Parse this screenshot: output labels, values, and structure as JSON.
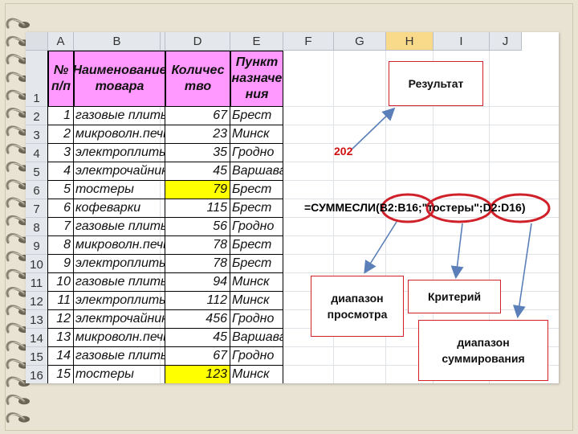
{
  "columns": [
    "A",
    "B",
    "",
    "D",
    "E",
    "F",
    "G",
    "H",
    "I",
    "J"
  ],
  "selected_column": "H",
  "rows": [
    "1",
    "2",
    "3",
    "4",
    "5",
    "6",
    "7",
    "8",
    "9",
    "10",
    "11",
    "12",
    "13",
    "14",
    "15",
    "16"
  ],
  "table_header": {
    "num": "№\nп/п",
    "name": "Наименование\nтовара",
    "qty": "Количес\nтво",
    "dest": "Пункт\nназначе\nния"
  },
  "table_rows": [
    {
      "num": "1",
      "name": "газовые плиты",
      "qty": "67",
      "dest": "Брест",
      "highlight": false
    },
    {
      "num": "2",
      "name": "микроволн.печь",
      "qty": "23",
      "dest": "Минск",
      "highlight": false
    },
    {
      "num": "3",
      "name": "электроплиты",
      "qty": "35",
      "dest": "Гродно",
      "highlight": false
    },
    {
      "num": "4",
      "name": "электрочайники",
      "qty": "45",
      "dest": "Варшава",
      "highlight": false
    },
    {
      "num": "5",
      "name": "тостеры",
      "qty": "79",
      "dest": "Брест",
      "highlight": true
    },
    {
      "num": "6",
      "name": "кофеварки",
      "qty": "115",
      "dest": "Брест",
      "highlight": false
    },
    {
      "num": "7",
      "name": "газовые плиты",
      "qty": "56",
      "dest": "Гродно",
      "highlight": false
    },
    {
      "num": "8",
      "name": "микроволн.печь",
      "qty": "78",
      "dest": "Брест",
      "highlight": false
    },
    {
      "num": "9",
      "name": "электроплиты",
      "qty": "78",
      "dest": "Брест",
      "highlight": false
    },
    {
      "num": "10",
      "name": "газовые плиты",
      "qty": "94",
      "dest": "Минск",
      "highlight": false
    },
    {
      "num": "11",
      "name": "электроплиты",
      "qty": "112",
      "dest": "Минск",
      "highlight": false
    },
    {
      "num": "12",
      "name": "электрочайники",
      "qty": "456",
      "dest": "Гродно",
      "highlight": false
    },
    {
      "num": "13",
      "name": "микроволн.печь",
      "qty": "45",
      "dest": "Варшава",
      "highlight": false
    },
    {
      "num": "14",
      "name": "газовые плиты",
      "qty": "67",
      "dest": "Гродно",
      "highlight": false
    },
    {
      "num": "15",
      "name": "тостеры",
      "qty": "123",
      "dest": "Минск",
      "highlight": true
    }
  ],
  "annotations": {
    "result_label": "Результат",
    "result_value": "202",
    "formula": "=СУММЕСЛИ(B2:B16;\"тостеры\";D2:D16)",
    "range_label": "диапазон\nпросмотра",
    "criterion_label": "Критерий",
    "sum_range_label": "диапазон\nсуммирования"
  },
  "colors": {
    "header_fill": "#ff99ff",
    "highlight_fill": "#ffff00",
    "selected_column_fill": "#f9d98a",
    "accent_red": "#d0202a",
    "arrow_blue": "#5b7fb8"
  }
}
